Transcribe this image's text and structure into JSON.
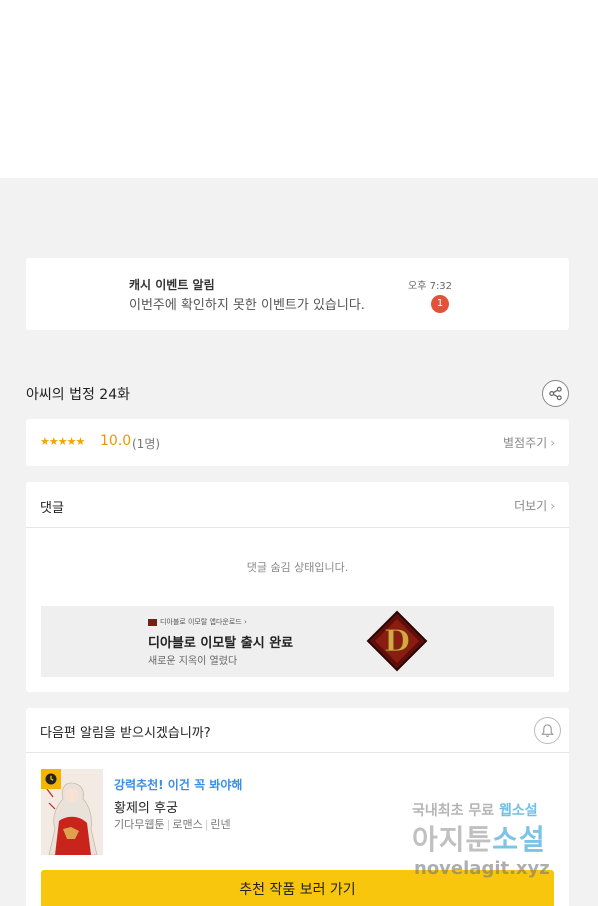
{
  "notification": {
    "title": "캐시 이벤트 알림",
    "message": "이번주에 확인하지 못한 이벤트가 있습니다.",
    "time": "오후 7:32",
    "badge_count": "1"
  },
  "episode": {
    "title": "아씨의 법정 24화",
    "share_icon": "share-icon"
  },
  "rating": {
    "stars": "★★★★★",
    "score": "10.0",
    "count": "(1명)",
    "rate_label": "별점주기",
    "star_color": "#f0a500"
  },
  "comments": {
    "title": "댓글",
    "more_label": "더보기",
    "hidden_message": "댓글 숨김 상태입니다."
  },
  "ad": {
    "small_text": "디아블로 이모탈 앱다운로드 ›",
    "title": "디아블로 이모탈 출시 완료",
    "subtitle": "새로운 지옥이 열렸다"
  },
  "next_episode": {
    "question": "다음편 알림을 받으시겠습니까?",
    "bell_icon": "bell-icon",
    "recommend_label": "강력추천! 이건 꼭 봐야해",
    "work_title": "황제의 후궁",
    "meta": [
      "기다무웹툰",
      "로맨스",
      "린넨"
    ],
    "cta_label": "추천 작품 보러 가기",
    "cta_color": "#f8c60c"
  },
  "watermark": {
    "line1_a": "국내최초 무료 ",
    "line1_b": "웹소설",
    "line2_a": "아지툰",
    "line2_b": "소설",
    "line3": "novelagit.xyz"
  }
}
